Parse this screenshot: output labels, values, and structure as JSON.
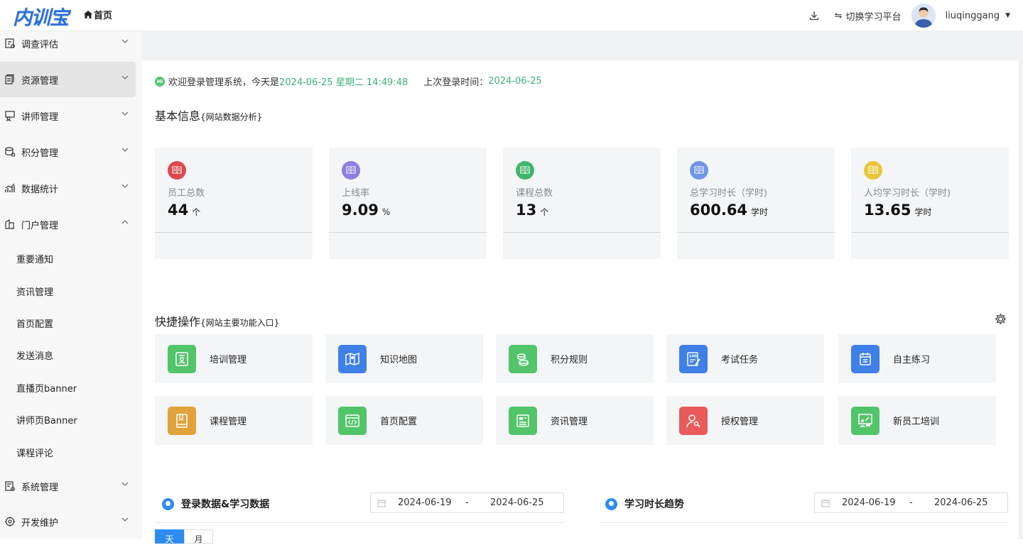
{
  "header": {
    "logo": "内训宝",
    "home_label": "首页",
    "switch_label": "切换学习平台",
    "username": "liuqinggang"
  },
  "sidebar": {
    "items": [
      {
        "label": "调查评估",
        "icon": "survey-icon",
        "expanded": false
      },
      {
        "label": "资源管理",
        "icon": "resource-icon",
        "expanded": false,
        "active": true
      },
      {
        "label": "讲师管理",
        "icon": "teacher-icon",
        "expanded": false
      },
      {
        "label": "积分管理",
        "icon": "points-icon",
        "expanded": false
      },
      {
        "label": "数据统计",
        "icon": "stats-icon",
        "expanded": false
      },
      {
        "label": "门户管理",
        "icon": "portal-icon",
        "expanded": true
      },
      {
        "label": "系统管理",
        "icon": "system-icon",
        "expanded": false
      },
      {
        "label": "开发维护",
        "icon": "devops-icon",
        "expanded": false
      }
    ],
    "subitems": [
      "重要通知",
      "资讯管理",
      "首页配置",
      "发送消息",
      "直播页banner",
      "讲师页Banner",
      "课程评论"
    ]
  },
  "welcome": {
    "prefix": "欢迎登录管理系统，今天是 ",
    "now": "2024-06-25 星期二 14:49:48",
    "last_label": "上次登录时间：",
    "last_date": "2024-06-25"
  },
  "basic": {
    "title": "基本信息",
    "subtitle": "{网站数据分析}",
    "stats": [
      {
        "label": "员工总数",
        "value": "44",
        "unit": "个",
        "color": "#e0474f"
      },
      {
        "label": "上线率",
        "value": "9.09",
        "unit": "%",
        "color": "#8f7ee0"
      },
      {
        "label": "课程总数",
        "value": "13",
        "unit": "个",
        "color": "#3fb66c"
      },
      {
        "label": "总学习时长（学时)",
        "value": "600.64",
        "unit": "学时",
        "color": "#6f95e8"
      },
      {
        "label": "人均学习时长（学时)",
        "value": "13.65",
        "unit": "学时",
        "color": "#e8c63a"
      }
    ]
  },
  "quick": {
    "title": "快捷操作",
    "subtitle": "{网站主要功能入口}",
    "items": [
      {
        "label": "培训管理",
        "icon": "training-icon",
        "color": "#52c46a"
      },
      {
        "label": "知识地图",
        "icon": "map-icon",
        "color": "#3f7fe8"
      },
      {
        "label": "积分规则",
        "icon": "coins-icon",
        "color": "#52c46a"
      },
      {
        "label": "考试任务",
        "icon": "exam-icon",
        "color": "#3f7fe8"
      },
      {
        "label": "自主练习",
        "icon": "calendar-icon",
        "color": "#3f7fe8"
      },
      {
        "label": "课程管理",
        "icon": "bookmark-icon",
        "color": "#e0a23a"
      },
      {
        "label": "首页配置",
        "icon": "code-icon",
        "color": "#52c46a"
      },
      {
        "label": "资讯管理",
        "icon": "news-icon",
        "color": "#52c46a"
      },
      {
        "label": "授权管理",
        "icon": "auth-icon",
        "color": "#ea5a5a"
      },
      {
        "label": "新员工培训",
        "icon": "newstaff-icon",
        "color": "#52c46a"
      }
    ]
  },
  "charts": {
    "login": {
      "title": "登录数据&学习数据",
      "start": "2024-06-19",
      "end": "2024-06-25",
      "sep": "-"
    },
    "trend": {
      "title": "学习时长趋势",
      "start": "2024-06-19",
      "end": "2024-06-25",
      "sep": "-"
    },
    "tabs": [
      "天",
      "月"
    ]
  }
}
